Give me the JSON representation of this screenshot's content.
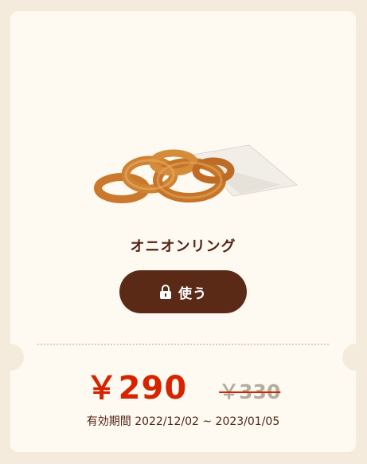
{
  "product": {
    "name": "オニオンリング",
    "image_alt": "onion-rings"
  },
  "button": {
    "label": "使う",
    "icon": "lock-icon"
  },
  "price": {
    "current": "￥290",
    "original": "￥330"
  },
  "validity": {
    "text": "有効期間 2022/12/02 ~ 2023/01/05"
  },
  "colors": {
    "background": "#f5ebdc",
    "card": "#fffaf1",
    "brown": "#5a2a16",
    "red": "#d62300",
    "gray": "#b5aca0"
  }
}
